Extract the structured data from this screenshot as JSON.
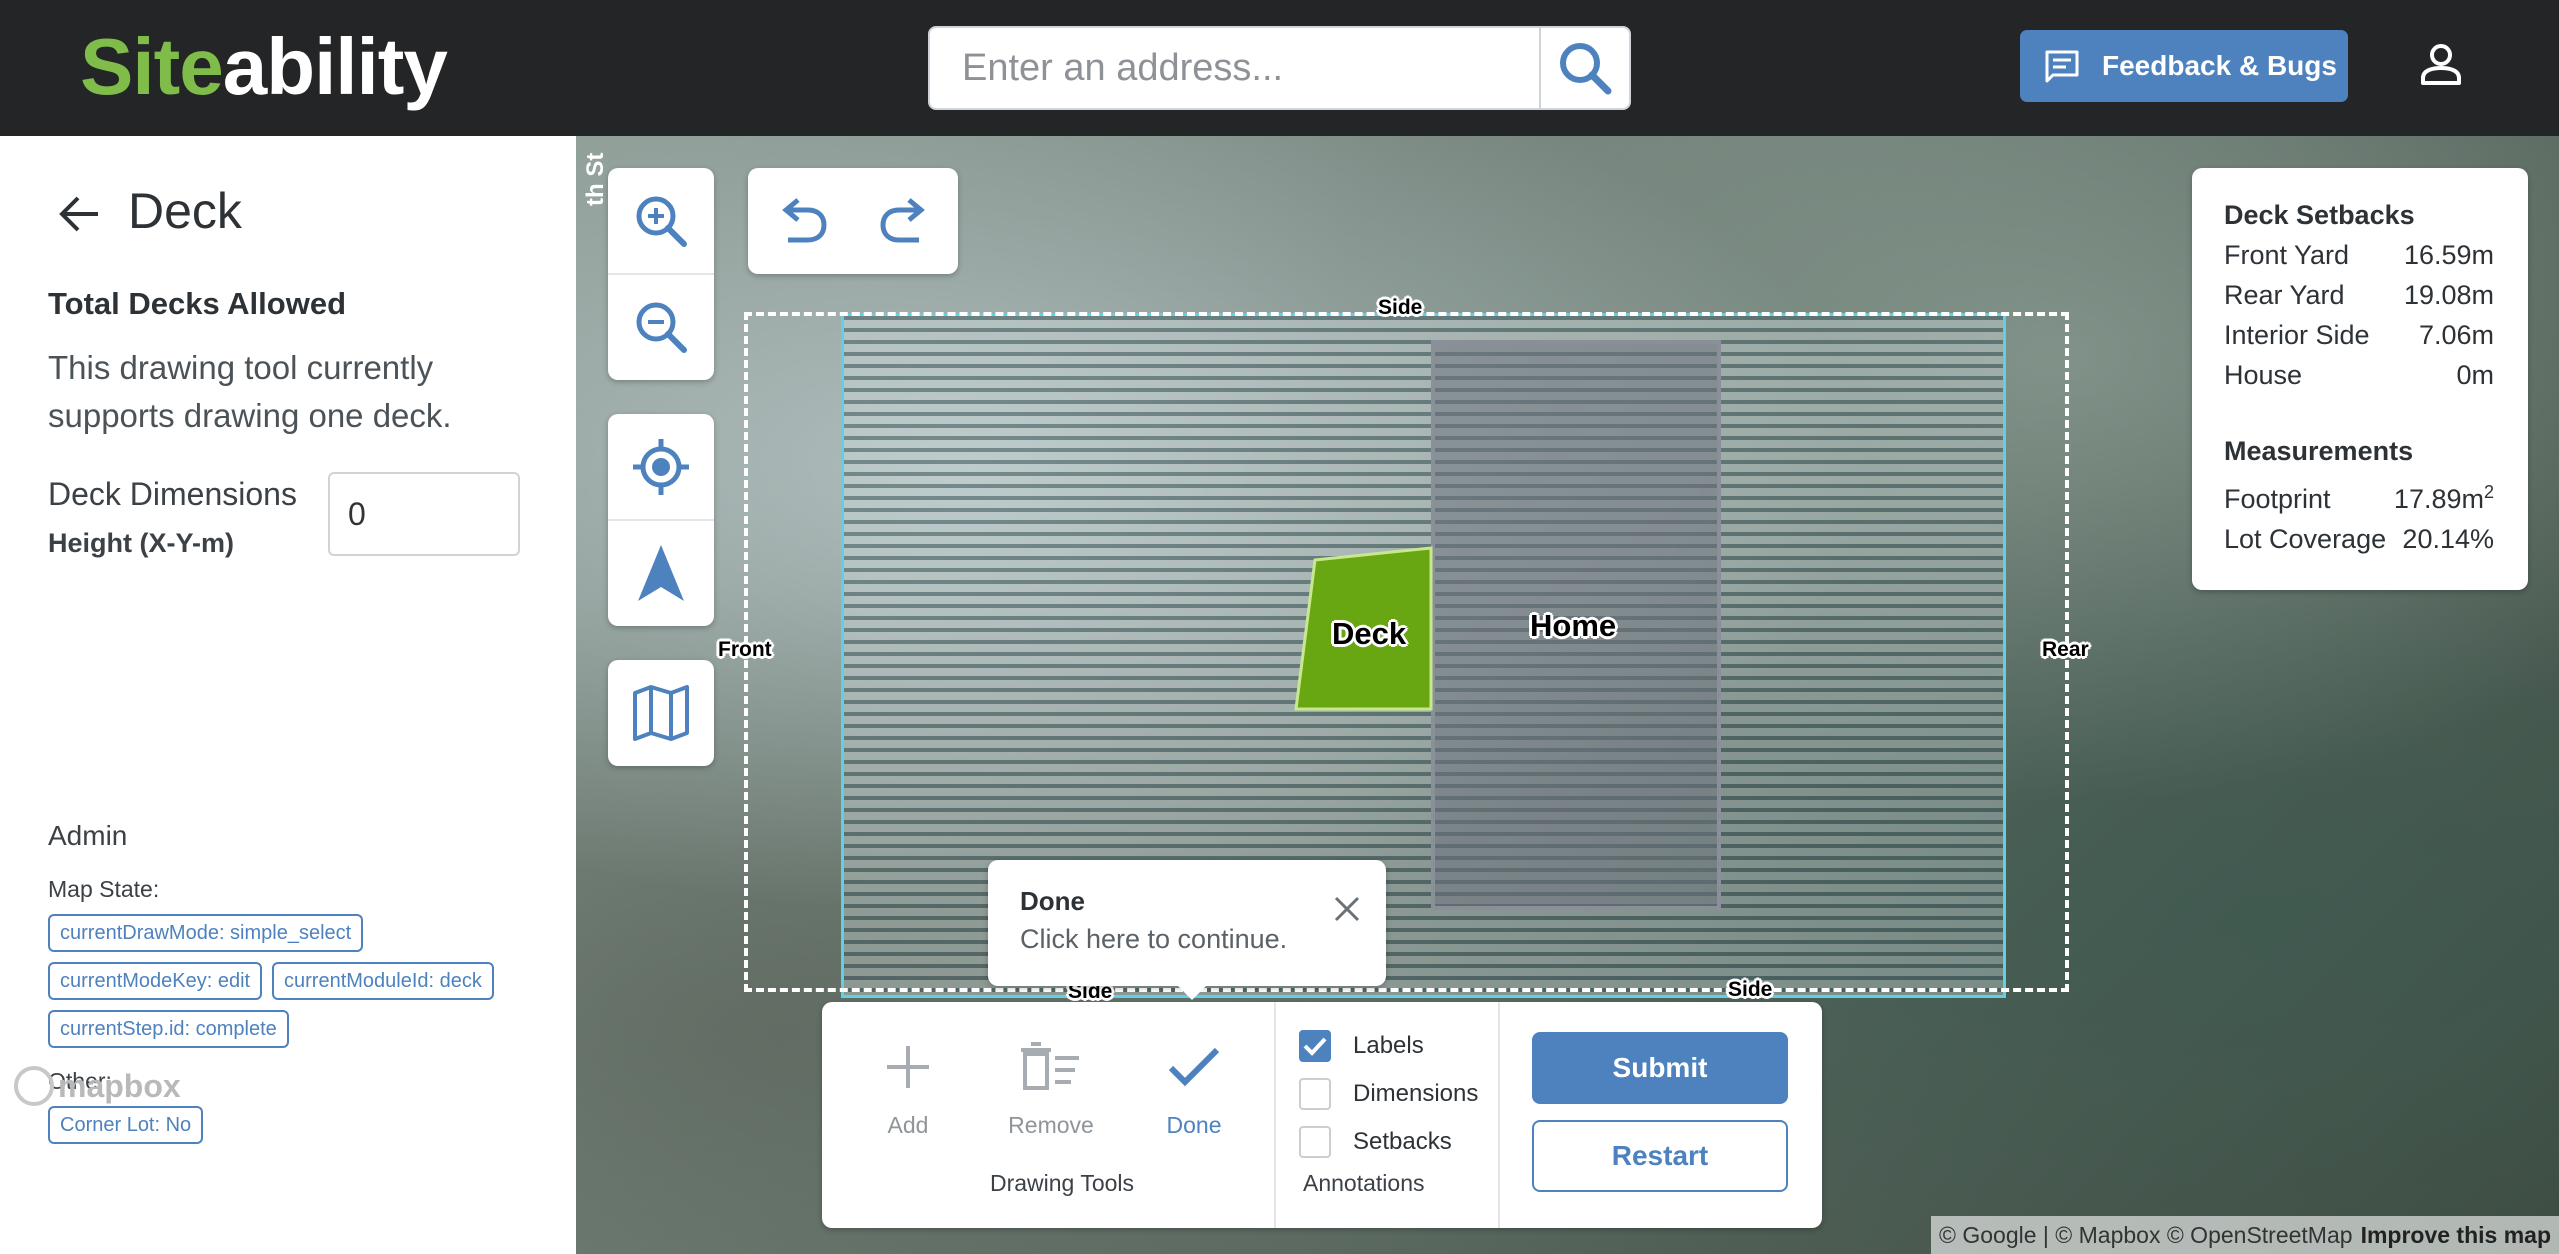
{
  "header": {
    "logo_part1": "Site",
    "logo_part2": "ability",
    "search_placeholder": "Enter an address...",
    "search_icon": "search-icon",
    "feedback_label": "Feedback & Bugs",
    "feedback_icon": "chat-icon",
    "user_icon": "user-icon",
    "brand_green": "#7fbc4a",
    "accent_blue": "#4d82be"
  },
  "sidebar": {
    "title": "Deck",
    "total_heading": "Total Decks Allowed",
    "description": "This drawing tool currently supports drawing one deck.",
    "dimensions_label": "Deck Dimensions",
    "dimensions_sublabel": "Height (X-Y-m)",
    "dimensions_value": "0",
    "admin_heading": "Admin",
    "map_state_label": "Map State:",
    "chips": [
      "currentDrawMode: simple_select",
      "currentModeKey: edit",
      "currentModuleId: deck",
      "currentStep.id: complete"
    ],
    "other_label": "Other:",
    "other_chip": "Corner Lot: No",
    "mapbox_logo": "mapbox"
  },
  "map": {
    "street_label": "th St",
    "labels": {
      "side_top": "Side",
      "front": "Front",
      "rear": "Rear",
      "side_bottom_left": "Side",
      "side_bottom_right": "Side",
      "deck": "Deck",
      "home": "Home"
    },
    "controls": [
      "zoom-in-icon",
      "zoom-out-icon",
      "locate-icon",
      "navigate-icon",
      "map-icon",
      "undo-icon",
      "redo-icon"
    ],
    "setbacks_panel": {
      "heading": "Deck Setbacks",
      "rows": [
        {
          "label": "Front Yard",
          "value": "16.59m"
        },
        {
          "label": "Rear Yard",
          "value": "19.08m"
        },
        {
          "label": "Interior Side",
          "value": "7.06m"
        },
        {
          "label": "House",
          "value": "0m"
        }
      ],
      "measurements_heading": "Measurements",
      "footprint_label": "Footprint",
      "footprint_value": "17.89m",
      "footprint_unit_sup": "2",
      "coverage_label": "Lot Coverage",
      "coverage_value": "20.14%"
    },
    "tooltip": {
      "title": "Done",
      "body": "Click here to continue."
    },
    "toolbar": {
      "add_label": "Add",
      "remove_label": "Remove",
      "done_label": "Done",
      "drawing_tools_label": "Drawing Tools",
      "labels_cb": "Labels",
      "dimensions_cb": "Dimensions",
      "setbacks_cb": "Setbacks",
      "annotations_label": "Annotations",
      "submit_label": "Submit",
      "restart_label": "Restart"
    },
    "attribution": "© Google | © Mapbox © OpenStreetMap",
    "improve_link": "Improve this map"
  }
}
